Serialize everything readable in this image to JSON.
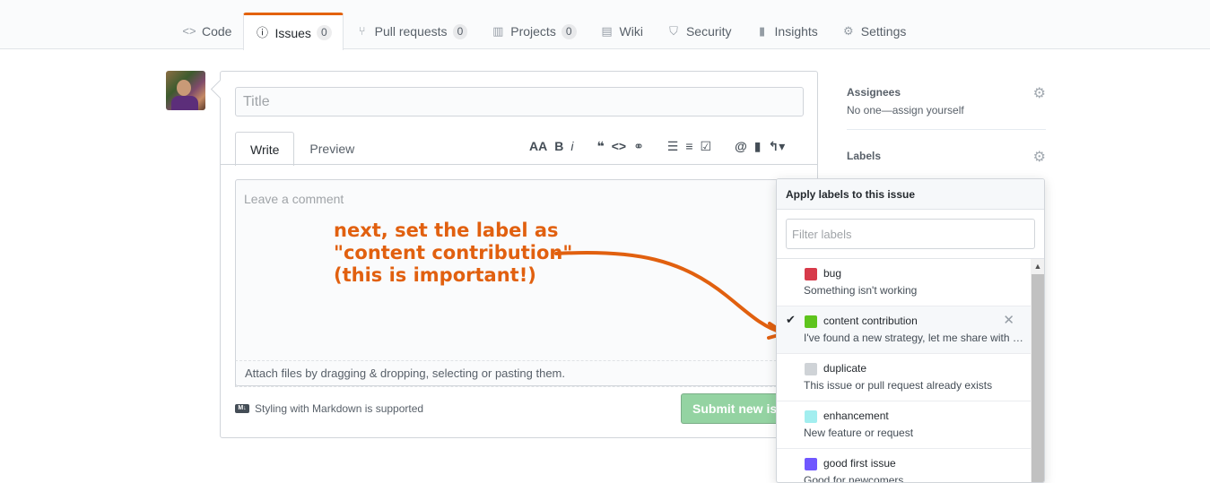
{
  "tabs": [
    {
      "label": "Code",
      "icon": "code-icon"
    },
    {
      "label": "Issues",
      "icon": "issue-icon",
      "count": "0"
    },
    {
      "label": "Pull requests",
      "icon": "pull-request-icon",
      "count": "0"
    },
    {
      "label": "Projects",
      "icon": "project-icon",
      "count": "0"
    },
    {
      "label": "Wiki",
      "icon": "book-icon"
    },
    {
      "label": "Security",
      "icon": "shield-icon"
    },
    {
      "label": "Insights",
      "icon": "graph-icon"
    },
    {
      "label": "Settings",
      "icon": "gear-icon"
    }
  ],
  "composer": {
    "title_placeholder": "Title",
    "write_tab": "Write",
    "preview_tab": "Preview",
    "comment_placeholder": "Leave a comment",
    "attach_text": "Attach files by dragging & dropping, selecting or pasting them.",
    "markdown_note": "Styling with Markdown is supported",
    "submit_label": "Submit new issue"
  },
  "annotation": {
    "line1": "next, set the label as",
    "line2": "\"content contribution\"",
    "line3": "(this is important!)",
    "color": "#e1600f"
  },
  "sidebar": {
    "assignees_title": "Assignees",
    "assignees_value": "No one—assign yourself",
    "labels_title": "Labels"
  },
  "labels_popover": {
    "title": "Apply labels to this issue",
    "filter_placeholder": "Filter labels",
    "items": [
      {
        "name": "bug",
        "description": "Something isn't working",
        "color": "#d73a4a",
        "checked": false
      },
      {
        "name": "content contribution",
        "description": "I've found a new strategy, let me share with you",
        "color": "#5ec41d",
        "checked": true
      },
      {
        "name": "duplicate",
        "description": "This issue or pull request already exists",
        "color": "#cfd3d7",
        "checked": false
      },
      {
        "name": "enhancement",
        "description": "New feature or request",
        "color": "#a2eeef",
        "checked": false
      },
      {
        "name": "good first issue",
        "description": "Good for newcomers",
        "color": "#7057ff",
        "checked": false
      }
    ]
  }
}
